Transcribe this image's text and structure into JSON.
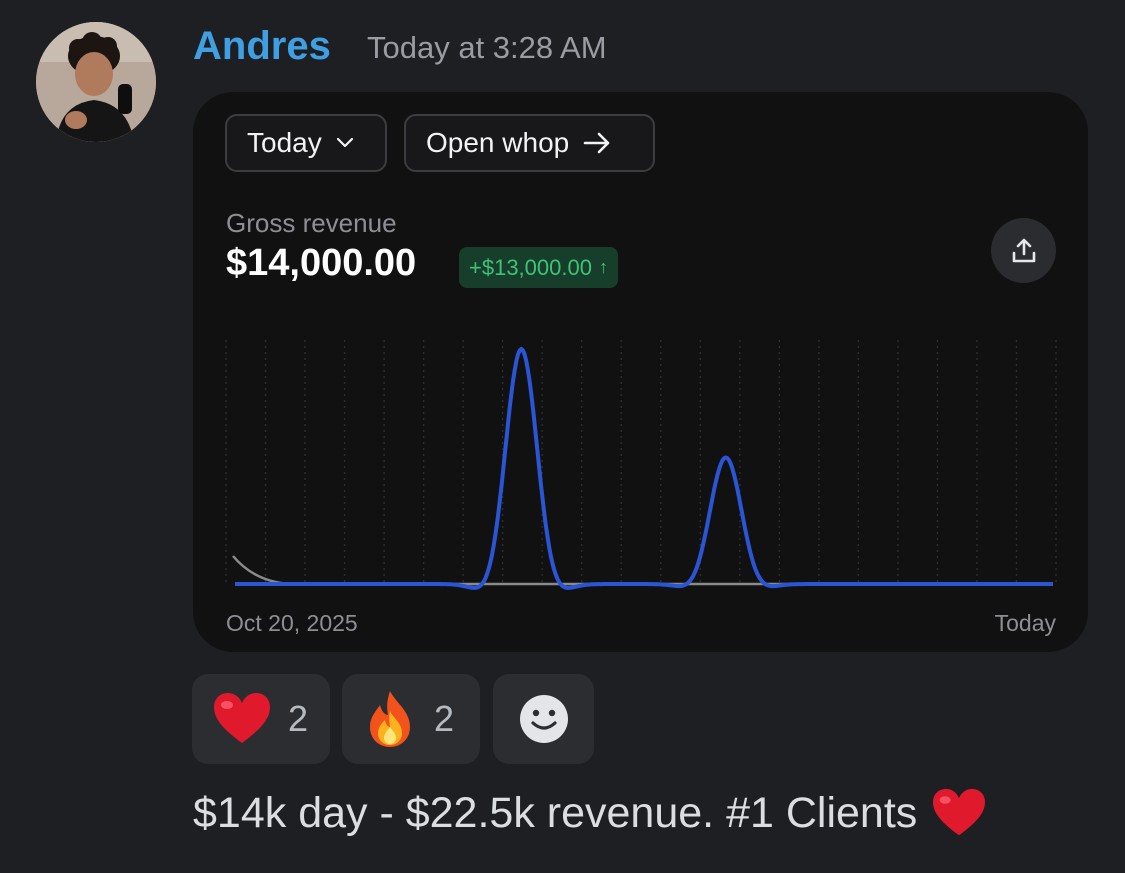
{
  "message": {
    "author": "Andres",
    "timestamp": "Today at 3:28 AM",
    "text": "$14k day - $22.5k revenue. #1 Clients",
    "text_emoji": "heart"
  },
  "embed": {
    "period_label": "Today",
    "open_label": "Open whop",
    "metric_label": "Gross revenue",
    "metric_value": "$14,000.00",
    "delta_value": "+$13,000.00",
    "delta_arrow": "↑",
    "x_start_label": "Oct 20, 2025",
    "x_end_label": "Today",
    "colors": {
      "line": "#2a56d6",
      "baseline": "#8a8a8a",
      "delta_text": "#3ec276",
      "delta_bg": "#173e2a"
    }
  },
  "reactions": [
    {
      "emoji": "heart",
      "count": "2"
    },
    {
      "emoji": "fire",
      "count": "2"
    },
    {
      "emoji": "add-reaction"
    }
  ],
  "chart_data": {
    "type": "line",
    "title": "",
    "xlabel": "",
    "ylabel": "",
    "x_start": "Oct 20, 2025",
    "x_end": "Today",
    "grid": true,
    "series": [
      {
        "x": [
          0,
          1,
          2,
          3,
          4,
          5,
          6,
          7,
          8,
          9,
          10,
          11,
          12,
          13,
          14,
          15,
          16,
          17,
          18,
          19,
          20
        ],
        "values": [
          0,
          0,
          0,
          0,
          0,
          0,
          0,
          13000,
          0,
          0,
          0,
          0,
          7000,
          0,
          0,
          0,
          0,
          0,
          0,
          0,
          0
        ]
      }
    ],
    "ylim": [
      0,
      13500
    ]
  }
}
